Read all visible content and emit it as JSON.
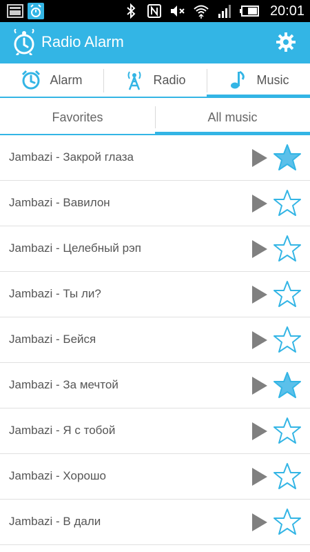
{
  "status_bar": {
    "time": "20:01",
    "icons": [
      "image-notification-icon",
      "alarm-notification-icon",
      "bluetooth-icon",
      "nfc-icon",
      "mute-icon",
      "wifi-icon",
      "signal-icon",
      "battery-icon"
    ]
  },
  "app": {
    "title": "Radio Alarm",
    "accent_color": "#33b5e5"
  },
  "tabs": [
    {
      "label": "Alarm",
      "icon": "alarm-clock-icon",
      "active": false
    },
    {
      "label": "Radio",
      "icon": "radio-tower-icon",
      "active": false
    },
    {
      "label": "Music",
      "icon": "music-note-icon",
      "active": true
    }
  ],
  "subtabs": [
    {
      "label": "Favorites",
      "active": false
    },
    {
      "label": "All music",
      "active": true
    }
  ],
  "tracks": [
    {
      "title": "Jambazi - Закрой глаза",
      "favorite": true
    },
    {
      "title": "Jambazi - Вавилон",
      "favorite": false
    },
    {
      "title": "Jambazi - Целебный рэп",
      "favorite": false
    },
    {
      "title": "Jambazi - Ты ли?",
      "favorite": false
    },
    {
      "title": "Jambazi - Бейся",
      "favorite": false
    },
    {
      "title": "Jambazi - За мечтой",
      "favorite": true
    },
    {
      "title": "Jambazi - Я с тобой",
      "favorite": false
    },
    {
      "title": "Jambazi - Хорошо",
      "favorite": false
    },
    {
      "title": "Jambazi - В дали",
      "favorite": false
    }
  ]
}
